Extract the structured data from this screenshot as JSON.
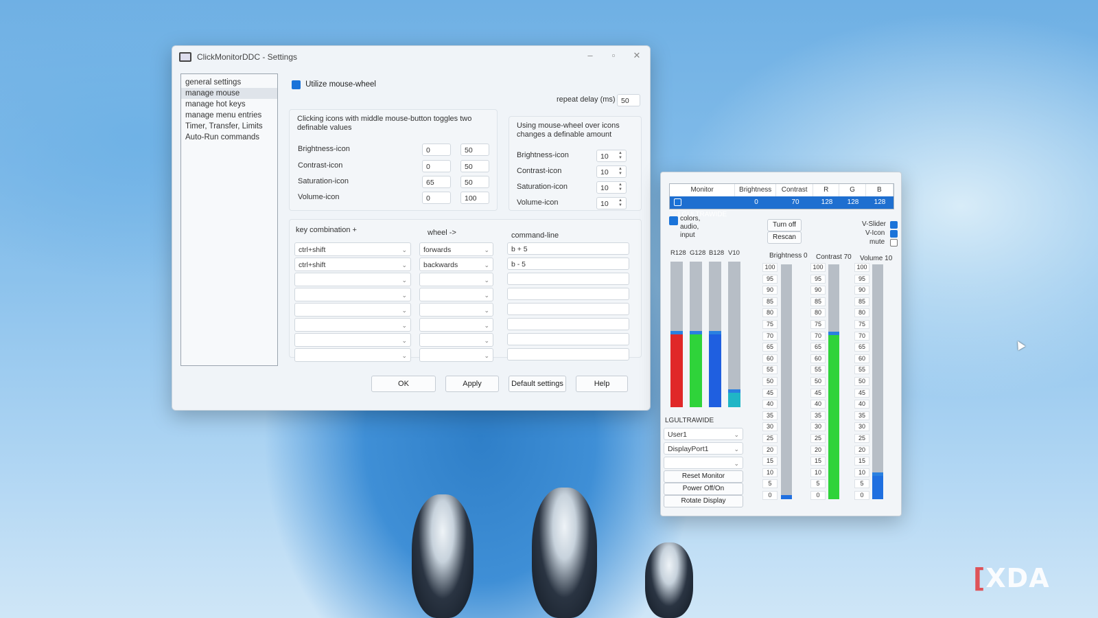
{
  "settings": {
    "title": "ClickMonitorDDC - Settings",
    "nav": [
      "general settings",
      "manage mouse",
      "manage hot keys",
      "manage menu entries",
      "Timer, Transfer, Limits",
      "Auto-Run commands"
    ],
    "utilize_label": "Utilize mouse-wheel",
    "repeat_delay_label": "repeat delay (ms)",
    "repeat_delay_value": "50",
    "left_group_desc": "Clicking icons with middle mouse-button toggles two definable values",
    "right_group_desc": "Using mouse-wheel over icons changes a definable amount",
    "icons": [
      {
        "name": "Brightness-icon",
        "v1": "0",
        "v2": "50",
        "amt": "10"
      },
      {
        "name": "Contrast-icon",
        "v1": "0",
        "v2": "50",
        "amt": "10"
      },
      {
        "name": "Saturation-icon",
        "v1": "65",
        "v2": "50",
        "amt": "10"
      },
      {
        "name": "Volume-icon",
        "v1": "0",
        "v2": "100",
        "amt": "10"
      }
    ],
    "col_key": "key combination  +",
    "col_wheel": "wheel  ->",
    "col_cmd": "command-line",
    "rows": [
      {
        "key": "ctrl+shift",
        "wheel": "forwards",
        "cmd": "b + 5"
      },
      {
        "key": "ctrl+shift",
        "wheel": "backwards",
        "cmd": "b - 5"
      },
      {
        "key": "",
        "wheel": "",
        "cmd": ""
      },
      {
        "key": "",
        "wheel": "",
        "cmd": ""
      },
      {
        "key": "",
        "wheel": "",
        "cmd": ""
      },
      {
        "key": "",
        "wheel": "",
        "cmd": ""
      },
      {
        "key": "",
        "wheel": "",
        "cmd": ""
      },
      {
        "key": "",
        "wheel": "",
        "cmd": ""
      }
    ],
    "buttons": {
      "ok": "OK",
      "apply": "Apply",
      "default": "Default settings",
      "help": "Help"
    }
  },
  "monitor": {
    "headers": [
      "Monitor",
      "Brightness",
      "Contrast",
      "R",
      "G",
      "B"
    ],
    "row": [
      "LGULTRAWIDE",
      "0",
      "70",
      "128",
      "128",
      "128"
    ],
    "options_label": "colors,\naudio,\ninput",
    "turn_off": "Turn off",
    "rescan": "Rescan",
    "vslider": "V-Slider",
    "vicon": "V-Icon",
    "mute": "mute",
    "rgb_labels": [
      "R128",
      "G128",
      "B128",
      "V10"
    ],
    "rgb_levels": [
      0.5,
      0.5,
      0.5,
      0.1
    ],
    "rgb_colors": [
      "#e02828",
      "#2fd33a",
      "#1f5fe0",
      "#20b6c6"
    ],
    "monitor_name": "LGULTRAWIDE",
    "preset": "User1",
    "input": "DisplayPort1",
    "extra_select": "",
    "reset": "Reset Monitor",
    "power": "Power Off/On",
    "rotate": "Rotate Display",
    "brightness_title": "Brightness 0",
    "contrast_title": "Contrast 70",
    "volume_title": "Volume 10",
    "brightness_level": 0,
    "contrast_level": 0.7,
    "volume_level": 0.1,
    "scale": [
      "100",
      "95",
      "90",
      "85",
      "80",
      "75",
      "70",
      "65",
      "60",
      "55",
      "50",
      "45",
      "40",
      "35",
      "30",
      "25",
      "20",
      "15",
      "10",
      "5",
      "0"
    ]
  },
  "watermark": "XDA"
}
